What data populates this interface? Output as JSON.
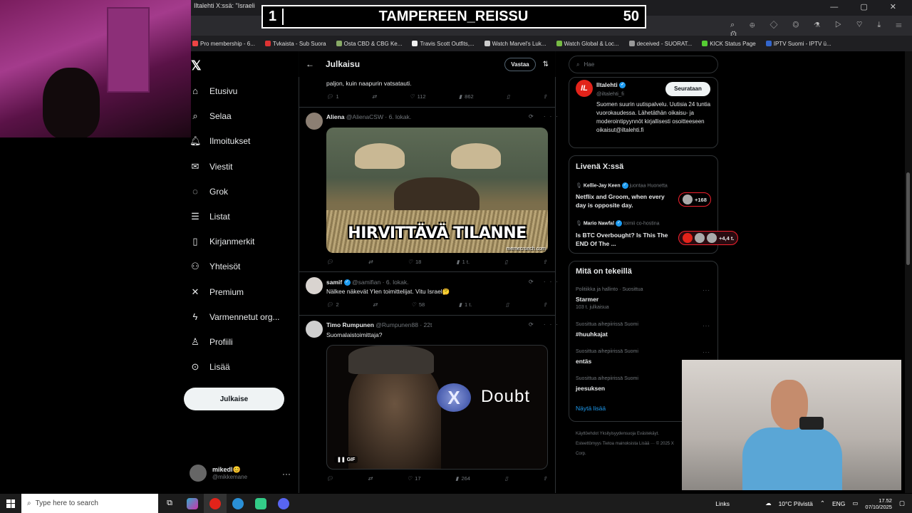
{
  "stream_overlay": {
    "left": "1",
    "title": "TAMPEREEN_REISSU",
    "right": "50"
  },
  "browser": {
    "tab_title": "Iltalehti X:ssä: \"Israeli",
    "window_controls": "— ▢ ✕",
    "bookmarks": [
      "Pro membership - 6...",
      "Tvkaista - Sub Suora",
      "Osta CBD & CBG Ke...",
      "Travis Scott Outfits,...",
      "Watch Marvel's Luk...",
      "Watch Global & Loc...",
      "deceived - SUORAT...",
      "KICK Status Page",
      "IPTV Suomi - IPTV ü..."
    ]
  },
  "nav": {
    "items": [
      {
        "label": "Etusivu",
        "icon": "home-icon"
      },
      {
        "label": "Selaa",
        "icon": "search-icon"
      },
      {
        "label": "Ilmoitukset",
        "icon": "bell-icon"
      },
      {
        "label": "Viestit",
        "icon": "mail-icon"
      },
      {
        "label": "Grok",
        "icon": "grok-icon"
      },
      {
        "label": "Listat",
        "icon": "list-icon"
      },
      {
        "label": "Kirjanmerkit",
        "icon": "bookmark-icon"
      },
      {
        "label": "Yhteisöt",
        "icon": "people-icon"
      },
      {
        "label": "Premium",
        "icon": "x-icon"
      },
      {
        "label": "Varmennetut org...",
        "icon": "bolt-icon"
      },
      {
        "label": "Profiili",
        "icon": "person-icon"
      },
      {
        "label": "Lisää",
        "icon": "more-circle-icon"
      }
    ],
    "post_button": "Julkaise",
    "account": {
      "name": "mikedl😊",
      "handle": "@mikkemane"
    }
  },
  "center": {
    "title": "Julkaisu",
    "reply_button": "Vastaa",
    "tweets": [
      {
        "text": "paljon, kuin naapurin vatsatauti.",
        "stats": {
          "replies": "1",
          "retweets": "",
          "likes": "112",
          "views": "862"
        }
      },
      {
        "name": "Aliena",
        "handle": "@AlienaCSW",
        "time": "6. lokak.",
        "image_caption": "HIRVITTÄVÄ TILANNE",
        "image_credit": "memecrunch.com",
        "stats": {
          "replies": "",
          "retweets": "",
          "likes": "18",
          "views": "1 t."
        }
      },
      {
        "name": "samif",
        "handle": "@samifian",
        "time": "6. lokak.",
        "text": "Nälkee näkevät Ylen toimittelijat. Vitu Israel🤔",
        "stats": {
          "replies": "2",
          "retweets": "",
          "likes": "58",
          "views": "1 t."
        }
      },
      {
        "name": "Timo Rumpunen",
        "handle": "@Rumpunen88",
        "time": "22t",
        "text": "Suomalaistoimittaja?",
        "gif_text": "Doubt",
        "gif_button": "X",
        "gif_label": "GIF",
        "stats": {
          "replies": "",
          "retweets": "",
          "likes": "17",
          "views": "264"
        }
      }
    ]
  },
  "right": {
    "search_placeholder": "Hae",
    "profile": {
      "name": "Iltalehti",
      "handle": "@iltalehti_fi",
      "logo": "IL",
      "follow_button": "Seurataan",
      "bio": "Suomen suurin uutispalvelu. Uutisia 24 tuntia vuorokaudessa. Lähetäthän oikaisu- ja moderointipyynnöt kirjallisesti osoitteeseen oikaisut@iltalehti.fi"
    },
    "live": {
      "title": "Livenä X:ssä",
      "items": [
        {
          "host": "Kellie-Jay Keen",
          "role": "juontaa Huonetta",
          "title": "Netflix and Groom, when every day is opposite day.",
          "count": "+168"
        },
        {
          "host": "Mario Nawfal",
          "role": "toimii co-hostina",
          "title": "Is BTC Overbought? Is This The END Of The ...",
          "count": "+4,4 t."
        }
      ]
    },
    "trends": {
      "title": "Mitä on tekeillä",
      "items": [
        {
          "category": "Politiikka ja hallinto · Suosittua",
          "name": "Starmer",
          "count": "103 t. julkaisua"
        },
        {
          "category": "Suosittua aihepiirissä Suomi",
          "name": "#huuhkajat",
          "count": ""
        },
        {
          "category": "Suosittua aihepiirissä Suomi",
          "name": "entäs",
          "count": ""
        },
        {
          "category": "Suosittua aihepiirissä Suomi",
          "name": "jeesuksen",
          "count": ""
        }
      ],
      "show_more": "Näytä lisää"
    },
    "footer": "Käyttöehdot   Yksityisyydensuoja   Evästekäyt.   Esteettömyys   Tietoa mainoksista   Lisää ···   © 2025 X Corp."
  },
  "taskbar": {
    "search_placeholder": "Type here to search",
    "links": "Links",
    "weather": "10°C  Pilvistä",
    "lang": "ENG",
    "time": "17.52",
    "date": "07/10/2025"
  }
}
